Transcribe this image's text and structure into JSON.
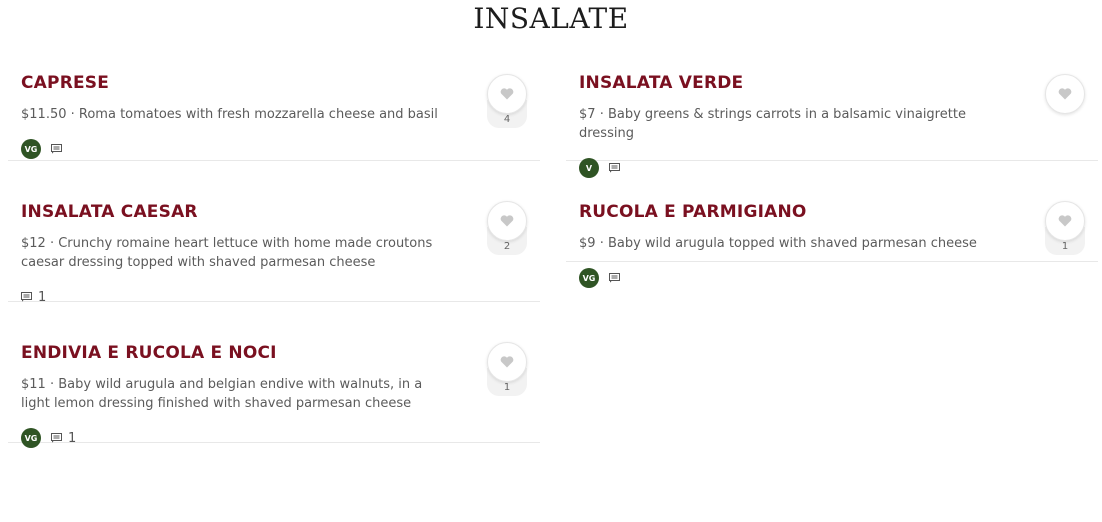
{
  "page": {
    "title": "INSALATE"
  },
  "menu": {
    "left": [
      {
        "name": "CAPRESE",
        "price": "$11.50",
        "description": "Roma tomatoes with fresh mozzarella cheese and basil",
        "badge": "VG",
        "comments": "",
        "likes": "4"
      },
      {
        "name": "INSALATA CAESAR",
        "price": "$12",
        "description": "Crunchy romaine heart lettuce with home made croutons caesar dressing topped with shaved parmesan cheese",
        "badge": "",
        "comments": "1",
        "likes": "2"
      },
      {
        "name": "ENDIVIA E RUCOLA E NOCI",
        "price": "$11",
        "description": "Baby wild arugula and belgian endive with walnuts, in a light lemon dressing finished with shaved parmesan cheese",
        "badge": "VG",
        "comments": "1",
        "likes": "1"
      }
    ],
    "right": [
      {
        "name": "INSALATA VERDE",
        "price": "$7",
        "description": "Baby greens & strings carrots in a balsamic vinaigrette dressing",
        "badge": "V",
        "comments": "",
        "likes": ""
      },
      {
        "name": "RUCOLA E PARMIGIANO",
        "price": "$9",
        "description": "Baby wild arugula topped with shaved parmesan cheese",
        "badge": "VG",
        "comments": "",
        "likes": "1"
      }
    ]
  },
  "colors": {
    "dish_name": "#7a1020",
    "badge_bg": "#2f5424"
  },
  "icons": {
    "like": "heart-icon",
    "comment": "comment-icon"
  }
}
